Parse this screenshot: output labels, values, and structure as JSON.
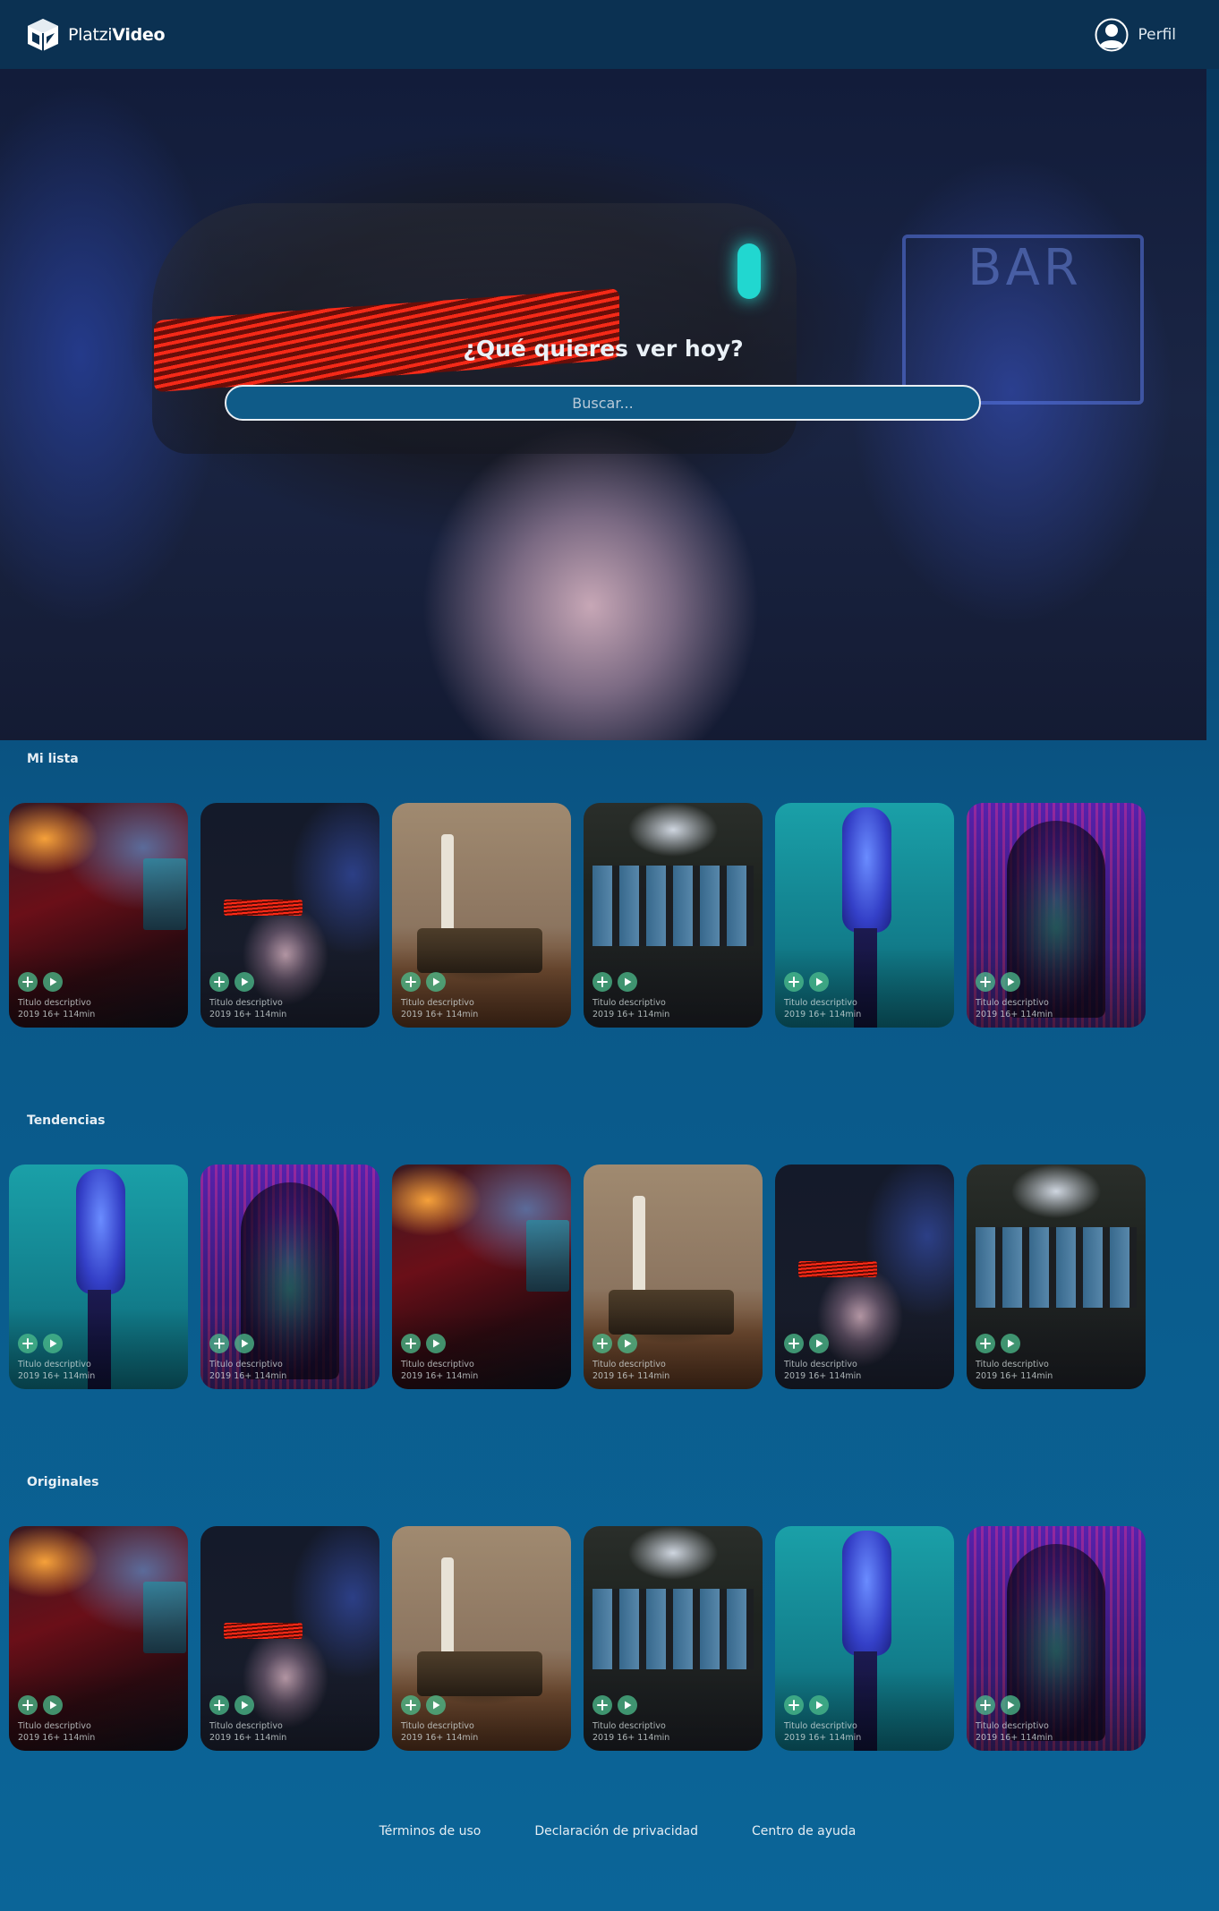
{
  "header": {
    "brand_light": "Platzi",
    "brand_bold": "Video",
    "profile_label": "Perfil"
  },
  "hero": {
    "title": "¿Qué quieres ver hoy?",
    "search_placeholder": "Buscar...",
    "sign_text": "BAR"
  },
  "sections": [
    {
      "title": "Mi lista",
      "cards": [
        {
          "art": "bar",
          "title": "Titulo descriptivo",
          "meta": "2019 16+ 114min"
        },
        {
          "art": "vr",
          "title": "Titulo descriptivo",
          "meta": "2019 16+ 114min"
        },
        {
          "art": "mars",
          "title": "Titulo descriptivo",
          "meta": "2019 16+ 114min"
        },
        {
          "art": "control",
          "title": "Titulo descriptivo",
          "meta": "2019 16+ 114min"
        },
        {
          "art": "hand",
          "title": "Titulo descriptivo",
          "meta": "2019 16+ 114min"
        },
        {
          "art": "glitch",
          "title": "Titulo descriptivo",
          "meta": "2019 16+ 114min"
        }
      ]
    },
    {
      "title": "Tendencias",
      "cards": [
        {
          "art": "hand",
          "title": "Titulo descriptivo",
          "meta": "2019 16+ 114min"
        },
        {
          "art": "glitch",
          "title": "Titulo descriptivo",
          "meta": "2019 16+ 114min"
        },
        {
          "art": "bar",
          "title": "Titulo descriptivo",
          "meta": "2019 16+ 114min"
        },
        {
          "art": "mars",
          "title": "Titulo descriptivo",
          "meta": "2019 16+ 114min"
        },
        {
          "art": "vr",
          "title": "Titulo descriptivo",
          "meta": "2019 16+ 114min"
        },
        {
          "art": "control",
          "title": "Titulo descriptivo",
          "meta": "2019 16+ 114min"
        }
      ]
    },
    {
      "title": "Originales",
      "cards": [
        {
          "art": "bar",
          "title": "Titulo descriptivo",
          "meta": "2019 16+ 114min"
        },
        {
          "art": "vr",
          "title": "Titulo descriptivo",
          "meta": "2019 16+ 114min"
        },
        {
          "art": "mars",
          "title": "Titulo descriptivo",
          "meta": "2019 16+ 114min"
        },
        {
          "art": "control",
          "title": "Titulo descriptivo",
          "meta": "2019 16+ 114min"
        },
        {
          "art": "hand",
          "title": "Titulo descriptivo",
          "meta": "2019 16+ 114min"
        },
        {
          "art": "glitch",
          "title": "Titulo descriptivo",
          "meta": "2019 16+ 114min"
        }
      ]
    }
  ],
  "footer": {
    "links": [
      "Términos de uso",
      "Declaración de privacidad",
      "Centro de ayuda"
    ]
  },
  "icons": {
    "logo": "platzi-video-cube-icon",
    "profile": "user-avatar-icon",
    "add": "plus-icon",
    "play": "play-icon"
  },
  "colors": {
    "header_bg": "#0b3152",
    "page_bg_top": "#08355a",
    "page_bg_bottom": "#0b6598",
    "search_bg": "#0f5b88",
    "card_button": "#4cbe8c",
    "vr_stripe": "#ff2a17",
    "vr_light": "#21d7d0"
  }
}
